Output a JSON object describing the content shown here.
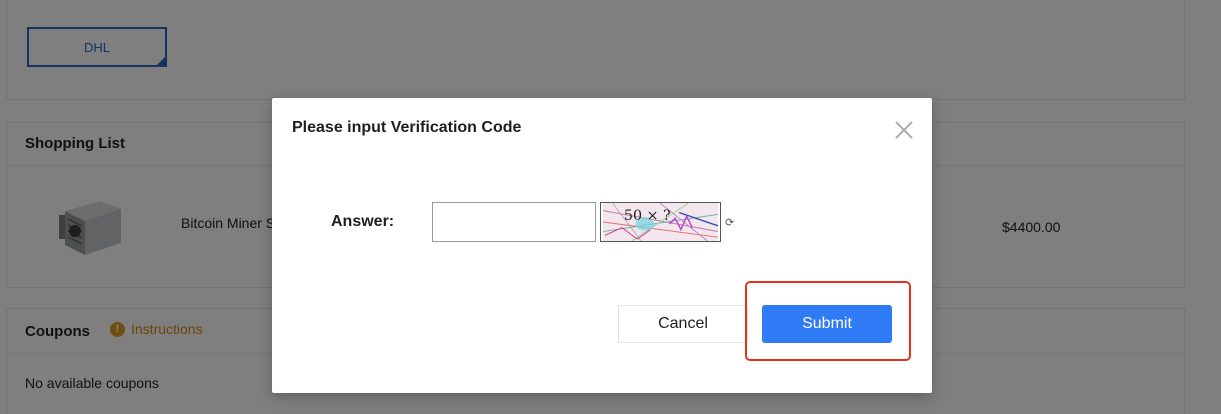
{
  "shipping": {
    "selected_option": "DHL"
  },
  "shopping_list": {
    "title": "Shopping List",
    "items": [
      {
        "name": "Bitcoin Miner S",
        "price": "$4400.00"
      }
    ]
  },
  "coupons": {
    "title": "Coupons",
    "instructions_label": "Instructions",
    "empty_text": "No available coupons"
  },
  "modal": {
    "title": "Please input Verification Code",
    "answer_label": "Answer:",
    "answer_value": "",
    "captcha_text": "50 × ?",
    "cancel_label": "Cancel",
    "submit_label": "Submit"
  },
  "colors": {
    "accent": "#2f7bf5",
    "selected_border": "#2d66c9",
    "warning": "#d48a16",
    "highlight": "#e2341d"
  },
  "icons": {
    "close": "close-icon",
    "refresh": "refresh-icon",
    "info": "info-icon",
    "selected_corner": "check-corner-icon"
  }
}
